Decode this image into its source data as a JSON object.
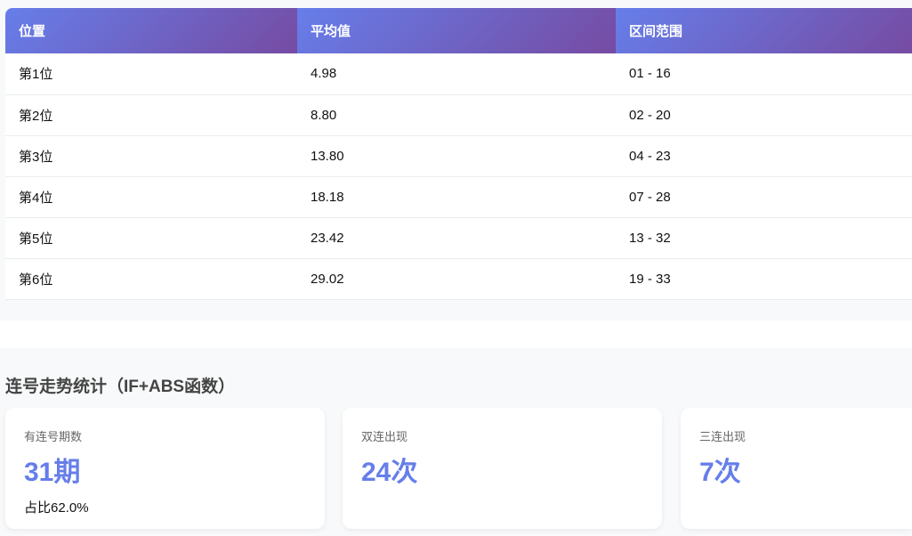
{
  "table": {
    "headers": [
      "位置",
      "平均值",
      "区间范围"
    ],
    "rows": [
      [
        "第1位",
        "4.98",
        "01 - 16"
      ],
      [
        "第2位",
        "8.80",
        "02 - 20"
      ],
      [
        "第3位",
        "13.80",
        "04 - 23"
      ],
      [
        "第4位",
        "18.18",
        "07 - 28"
      ],
      [
        "第5位",
        "23.42",
        "13 - 32"
      ],
      [
        "第6位",
        "29.02",
        "19 - 33"
      ]
    ]
  },
  "consecutive": {
    "title": "连号走势统计（IF+ABS函数）",
    "cards": [
      {
        "label": "有连号期数",
        "value": "31期",
        "sub": "占比62.0%"
      },
      {
        "label": "双连出现",
        "value": "24次"
      },
      {
        "label": "三连出现",
        "value": "7次"
      }
    ]
  }
}
